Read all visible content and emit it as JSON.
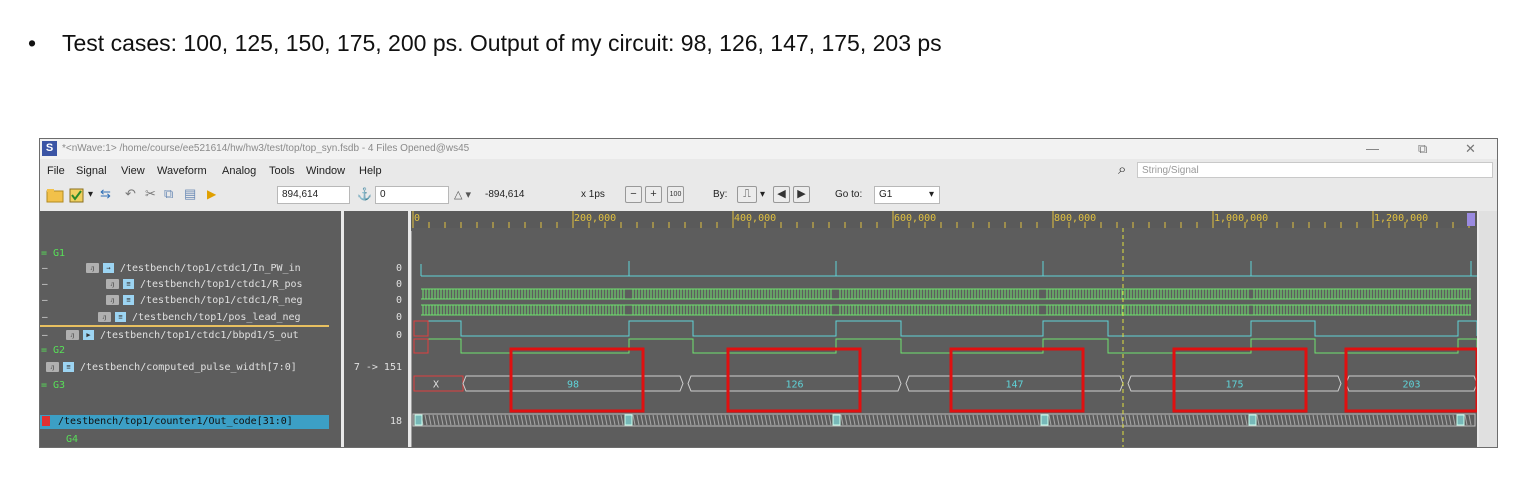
{
  "bullet": "Test cases: 100, 125, 150, 175, 200 ps. Output of my circuit: 98, 126, 147, 175, 203 ps",
  "window": {
    "title": "*<nWave:1> /home/course/ee521614/hw/hw3/test/top/top_syn.fsdb - 4 Files Opened@ws45",
    "app_icon_letter": "S",
    "controls": {
      "minimize": "—",
      "restore": "⧉",
      "close": "✕"
    }
  },
  "menu": [
    "File",
    "Signal",
    "View",
    "Waveform",
    "Analog",
    "Tools",
    "Window",
    "Help"
  ],
  "search": {
    "placeholder": "String/Signal"
  },
  "toolbar": {
    "cursor_time": "894,614",
    "marker_time": "0",
    "delta": "-894,614",
    "scale": "x 1ps",
    "zoom_fit": "100",
    "by_label": "By:",
    "goto_label": "Go to:",
    "goto_value": "G1"
  },
  "signals": [
    {
      "kind": "group",
      "label": "= G1"
    },
    {
      "kind": "signal",
      "badge": "ԓ",
      "path": "/testbench/top1/ctdc1/In_PW_in",
      "value": "0"
    },
    {
      "kind": "signal",
      "badge": "ԓ",
      "path": "/testbench/top1/ctdc1/R_pos",
      "value": "0"
    },
    {
      "kind": "signal",
      "badge": "ԓ",
      "path": "/testbench/top1/ctdc1/R_neg",
      "value": "0"
    },
    {
      "kind": "signal",
      "badge": "ԓ",
      "path": "/testbench/top1/pos_lead_neg",
      "value": "0"
    },
    {
      "kind": "signal",
      "badge": "ԓ",
      "path": "/testbench/top1/ctdc1/bbpd1/S_out",
      "value": "0"
    },
    {
      "kind": "group",
      "label": "= G2"
    },
    {
      "kind": "signal",
      "badge": "ԓ",
      "path": "/testbench/computed_pulse_width[7:0]",
      "value": "7 -> 151"
    },
    {
      "kind": "group",
      "label": "= G3"
    },
    {
      "kind": "signal",
      "badge": "",
      "path": "/testbench/top1/counter1/Out_code[31:0]",
      "value": "18",
      "selected": true
    },
    {
      "kind": "group",
      "label": "G4"
    }
  ],
  "ruler": {
    "start_label": "0",
    "labels": [
      "200,000",
      "400,000",
      "600,000",
      "800,000",
      "1,000,000",
      "1,200,000"
    ]
  },
  "bus": {
    "initial": "X",
    "segments": [
      "98",
      "126",
      "147",
      "175",
      "203"
    ]
  },
  "colors": {
    "panel_bg": "#5d5d5d",
    "wave_cyan": "#5fd3d8",
    "wave_green": "#6fe36f",
    "highlight_red": "#e01010",
    "cursor_yellow": "#e0e040"
  }
}
